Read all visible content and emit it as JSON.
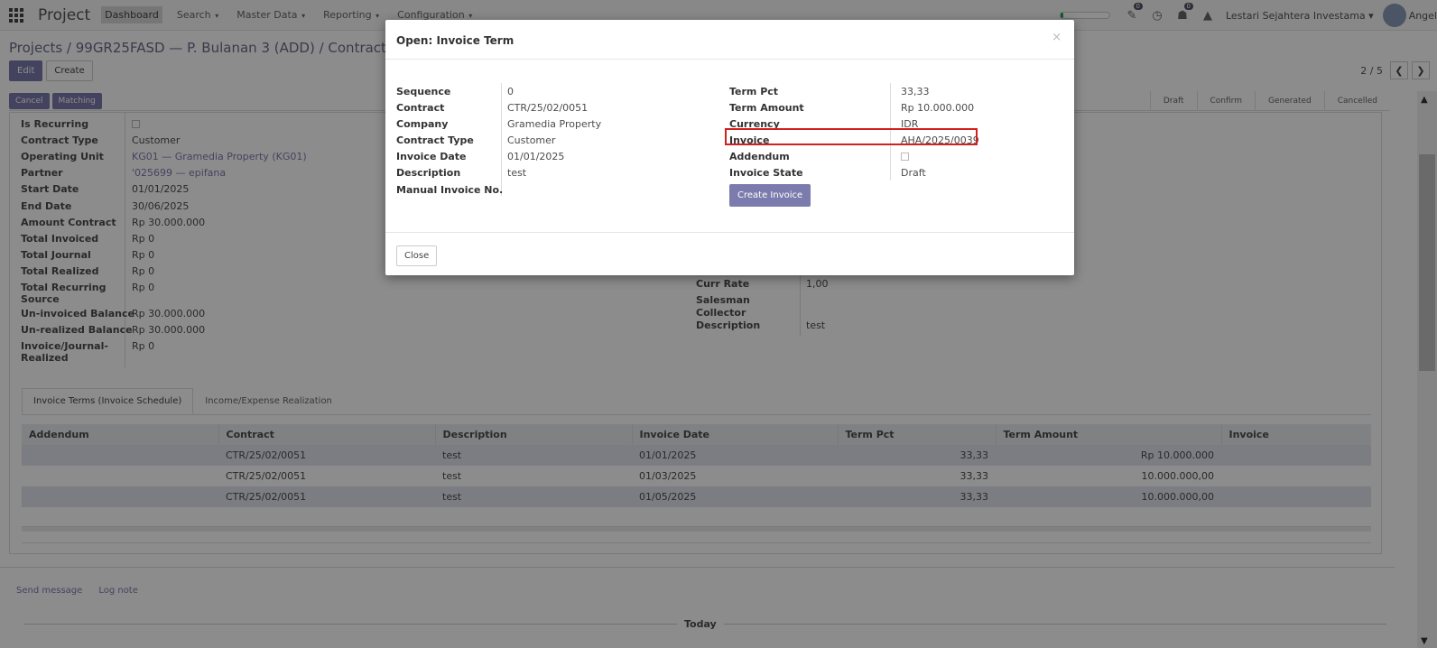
{
  "topnav": {
    "brand": "Project",
    "menu": [
      "Dashboard",
      "Search",
      "Master Data",
      "Reporting",
      "Configuration"
    ],
    "badges": {
      "activity": "0",
      "chat": "0"
    },
    "company": "Lestari Sejahtera Investama",
    "user": "Angel",
    "progress": 0.05,
    "progress_color": "#28a745"
  },
  "breadcrumb": "Projects / 99GR25FASD — P. Bulanan 3 (ADD) / Contracts / CTR",
  "control": {
    "edit": "Edit",
    "create": "Create",
    "pager": "2 / 5"
  },
  "statusbar": {
    "buttons": [
      "Cancel",
      "Matching"
    ],
    "stages": [
      "Draft",
      "Confirm",
      "Generated",
      "Cancelled"
    ]
  },
  "form": {
    "left": [
      {
        "label": "Is Recurring",
        "value": "",
        "checkbox": true
      },
      {
        "label": "Contract Type",
        "value": "Customer"
      },
      {
        "label": "Operating Unit",
        "value": "KG01 — Gramedia Property (KG01)",
        "link": true
      },
      {
        "label": "Partner",
        "value": "'025699 — epifana",
        "link": true
      },
      {
        "label": "Start Date",
        "value": "01/01/2025"
      },
      {
        "label": "End Date",
        "value": "30/06/2025"
      },
      {
        "label": "Amount Contract",
        "value": "Rp 30.000.000"
      },
      {
        "label": "Total Invoiced",
        "value": "Rp 0"
      },
      {
        "label": "Total Journal",
        "value": "Rp 0"
      },
      {
        "label": "Total Realized",
        "value": "Rp 0"
      },
      {
        "label": "Total Recurring Source",
        "value": "Rp 0"
      },
      {
        "label": "Un-invoiced Balance",
        "value": "Rp 30.000.000"
      },
      {
        "label": "Un-realized Balance",
        "value": "Rp 30.000.000"
      },
      {
        "label": "Invoice/Journal-Realized",
        "value": "Rp 0"
      }
    ],
    "right": [
      {
        "label": "Curr Rate",
        "value": "1,00"
      },
      {
        "label": "Salesman",
        "value": ""
      },
      {
        "label": "Collector",
        "value": ""
      },
      {
        "label": "Description",
        "value": "test"
      }
    ]
  },
  "tabs": [
    "Invoice Terms (Invoice Schedule)",
    "Income/Expense Realization"
  ],
  "table": {
    "columns": [
      "Addendum",
      "Contract",
      "Description",
      "Invoice Date",
      "Term Pct",
      "Term Amount",
      "Invoice"
    ],
    "rows": [
      [
        "",
        "CTR/25/02/0051",
        "test",
        "01/01/2025",
        "33,33",
        "Rp 10.000.000",
        ""
      ],
      [
        "",
        "CTR/25/02/0051",
        "test",
        "01/03/2025",
        "33,33",
        "10.000.000,00",
        ""
      ],
      [
        "",
        "CTR/25/02/0051",
        "test",
        "01/05/2025",
        "33,33",
        "10.000.000,00",
        ""
      ]
    ]
  },
  "chatter": {
    "send": "Send message",
    "log": "Log note",
    "today": "Today"
  },
  "modal": {
    "title": "Open: Invoice Term",
    "close_x": "×",
    "left": [
      {
        "label": "Sequence",
        "value": "0"
      },
      {
        "label": "Contract",
        "value": "CTR/25/02/0051",
        "link": true
      },
      {
        "label": "Company",
        "value": "Gramedia Property",
        "link": true
      },
      {
        "label": "Contract Type",
        "value": "Customer"
      },
      {
        "label": "Invoice Date",
        "value": "01/01/2025"
      },
      {
        "label": "Description",
        "value": "test"
      },
      {
        "label": "Manual Invoice No.",
        "value": ""
      }
    ],
    "right": [
      {
        "label": "Term Pct",
        "value": "33,33"
      },
      {
        "label": "Term Amount",
        "value": "Rp 10.000.000"
      },
      {
        "label": "Currency",
        "value": "IDR",
        "link": true
      },
      {
        "label": "Invoice",
        "value": "AHA/2025/0039",
        "link": true
      },
      {
        "label": "Addendum",
        "value": "",
        "checkbox": true
      },
      {
        "label": "Invoice State",
        "value": "Draft"
      }
    ],
    "create_invoice": "Create Invoice",
    "close": "Close"
  }
}
